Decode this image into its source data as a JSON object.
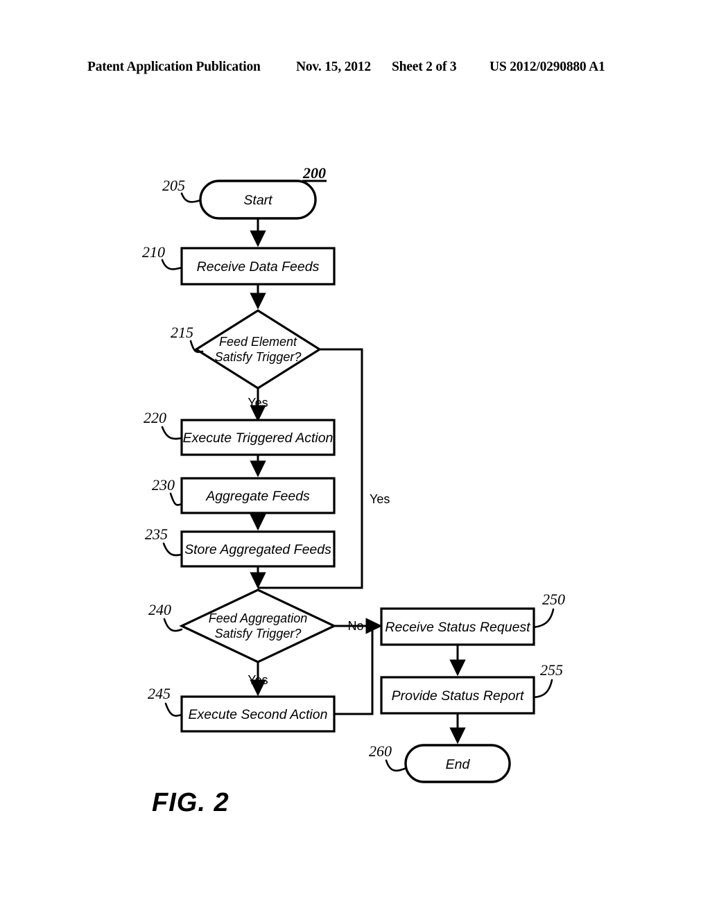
{
  "header": {
    "publication": "Patent Application Publication",
    "date": "Nov. 15, 2012",
    "sheet": "Sheet 2 of 3",
    "patent_number": "US 2012/0290880 A1"
  },
  "figure": {
    "caption": "FIG. 2",
    "diagram_ref": "200"
  },
  "flowchart": {
    "nodes": [
      {
        "ref": "205",
        "label": "Start",
        "shape": "terminator"
      },
      {
        "ref": "210",
        "label": "Receive Data Feeds",
        "shape": "process"
      },
      {
        "ref": "215",
        "label_line1": "Feed Element",
        "label_line2": "Satisfy Trigger?",
        "shape": "decision"
      },
      {
        "ref": "220",
        "label": "Execute Triggered Action",
        "shape": "process"
      },
      {
        "ref": "230",
        "label": "Aggregate Feeds",
        "shape": "process"
      },
      {
        "ref": "235",
        "label": "Store Aggregated Feeds",
        "shape": "process"
      },
      {
        "ref": "240",
        "label_line1": "Feed Aggregation",
        "label_line2": "Satisfy Trigger?",
        "shape": "decision"
      },
      {
        "ref": "245",
        "label": "Execute Second Action",
        "shape": "process"
      },
      {
        "ref": "250",
        "label": "Receive Status Request",
        "shape": "process"
      },
      {
        "ref": "255",
        "label": "Provide Status Report",
        "shape": "process"
      },
      {
        "ref": "260",
        "label": "End",
        "shape": "terminator"
      }
    ],
    "edge_labels": {
      "yes_215": "Yes",
      "no_215": "Yes",
      "yes_240": "Yes",
      "no_240": "No"
    }
  }
}
